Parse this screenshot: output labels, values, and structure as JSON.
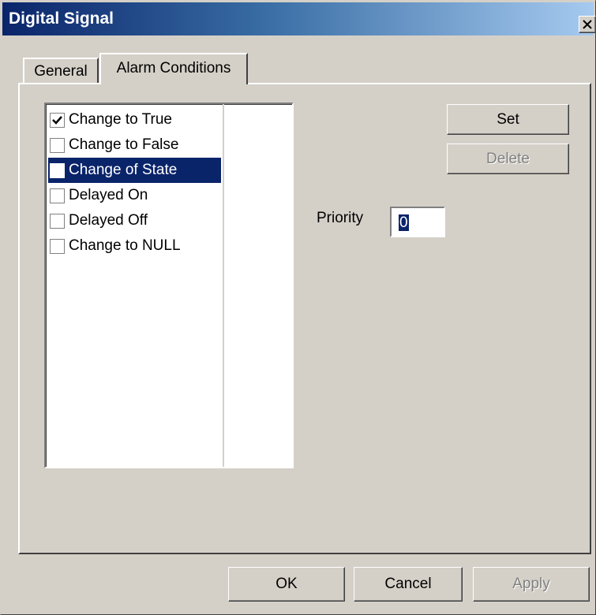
{
  "window": {
    "title": "Digital Signal",
    "close_glyph": "close-icon"
  },
  "tabs": [
    {
      "label": "General",
      "active": false
    },
    {
      "label": "Alarm Conditions",
      "active": true
    }
  ],
  "conditions": [
    {
      "label": "Change to True",
      "checked": true,
      "selected": false
    },
    {
      "label": "Change to False",
      "checked": false,
      "selected": false
    },
    {
      "label": "Change of State",
      "checked": false,
      "selected": true
    },
    {
      "label": "Delayed On",
      "checked": false,
      "selected": false
    },
    {
      "label": "Delayed Off",
      "checked": false,
      "selected": false
    },
    {
      "label": "Change to NULL",
      "checked": false,
      "selected": false
    }
  ],
  "actions": {
    "set_label": "Set",
    "delete_label": "Delete"
  },
  "priority": {
    "label": "Priority",
    "value": "0"
  },
  "footer": {
    "ok_label": "OK",
    "cancel_label": "Cancel",
    "apply_label": "Apply"
  },
  "colors": {
    "selection": "#0a246a",
    "face": "#d4d0c8",
    "disabled_text": "#808080"
  }
}
